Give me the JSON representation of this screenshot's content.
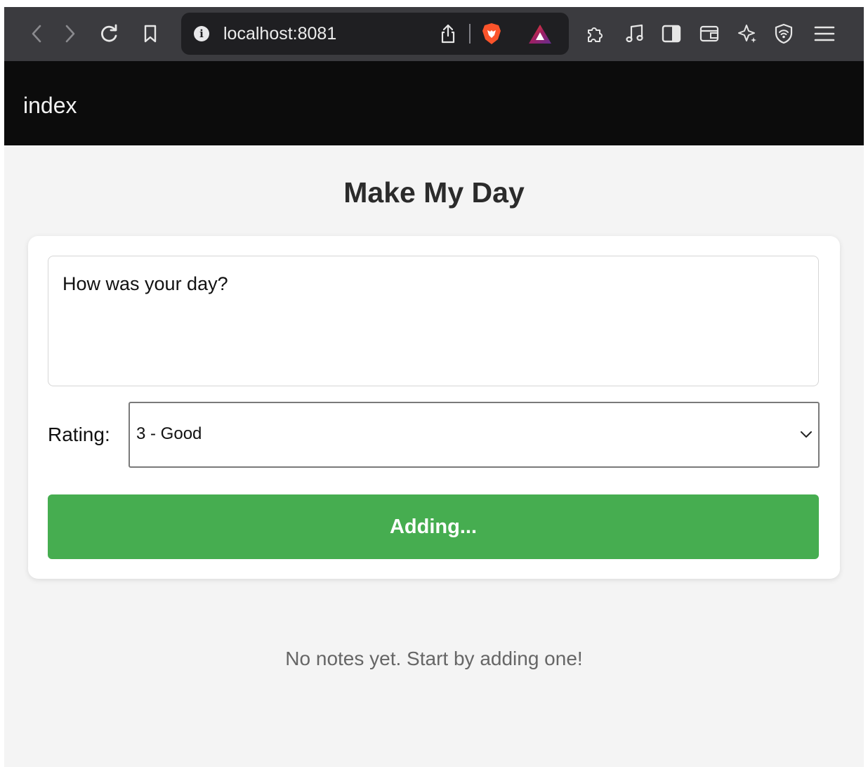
{
  "browser": {
    "url": "localhost:8081",
    "icons": [
      "back-icon",
      "forward-icon",
      "reload-icon",
      "bookmark-icon",
      "site-info-icon",
      "share-icon",
      "brave-shields-icon",
      "brave-rewards-icon",
      "extensions-icon",
      "media-icon",
      "sidebar-icon",
      "wallet-icon",
      "leo-ai-icon",
      "vpn-icon",
      "menu-icon"
    ],
    "info_glyph": "i"
  },
  "app": {
    "header_title": "index"
  },
  "main": {
    "title": "Make My Day",
    "form": {
      "note_placeholder": "How was your day?",
      "note_value": "",
      "rating_label": "Rating:",
      "rating_selected": "3 - Good",
      "submit_label": "Adding..."
    },
    "empty_message": "No notes yet. Start by adding one!"
  },
  "colors": {
    "toolbar": "#3b3b3f",
    "header": "#0c0c0c",
    "background": "#f4f4f4",
    "button": "#46ad50"
  }
}
